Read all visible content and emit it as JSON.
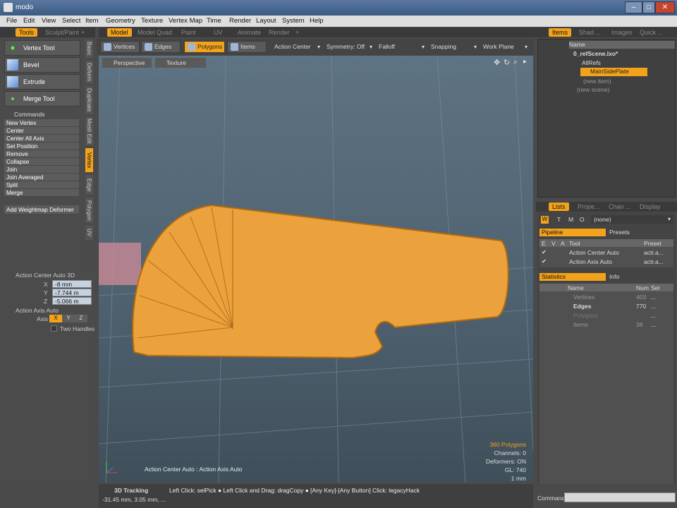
{
  "title": "modo",
  "menu": [
    "File",
    "Edit",
    "View",
    "Select",
    "Item",
    "Geometry",
    "Texture",
    "Vertex Map",
    "Time",
    "Render",
    "Layout",
    "System",
    "Help"
  ],
  "left_tabs": [
    "Tools",
    "Sculpt/Paint",
    "+"
  ],
  "tools": [
    {
      "label": "Vertex Tool",
      "icon": "vertex-tool-icon"
    },
    {
      "label": "Bevel",
      "icon": "bevel-icon"
    },
    {
      "label": "Extrude",
      "icon": "extrude-icon"
    },
    {
      "label": "Merge Tool",
      "icon": "merge-tool-icon"
    }
  ],
  "commands_header": "Commands",
  "commands": [
    "New Vertex",
    "Center",
    "Center All Axis",
    "Set Position",
    "Remove",
    "Collapse",
    "Join",
    "Join Averaged",
    "Split",
    "Merge"
  ],
  "add_weightmap": "Add Weightmap Deformer",
  "vtabs": [
    "Basic",
    "Deform",
    "Duplicate",
    "Mesh Edit",
    "Vertex",
    "Edge",
    "Polygon",
    "UV"
  ],
  "action_center": {
    "title": "Action Center Auto 3D",
    "x_label": "X",
    "y_label": "Y",
    "z_label": "Z",
    "x": "-8 mm",
    "y": "-7.744 m",
    "z": "-5.066 m"
  },
  "action_axis": {
    "title": "Action Axis Auto",
    "axis_label": "Axis",
    "x": "X",
    "y": "Y",
    "z": "Z",
    "two_handles": "Two Handles"
  },
  "viewport_tabs": [
    "Model",
    "Model Quad",
    "Paint",
    "UV",
    "Animate",
    "Render",
    "+"
  ],
  "modes": [
    "Vertices",
    "Edges",
    "Polygons",
    "Items"
  ],
  "dropdowns": [
    "Action Center",
    "Symmetry: Off",
    "Falloff",
    "Snapping",
    "Work Plane"
  ],
  "view": {
    "perspective": "Perspective",
    "texture": "Texture"
  },
  "overlay": {
    "polygons": "360 Polygons",
    "channels": "Channels: 0",
    "deformers": "Deformers: ON",
    "gl": "GL: 740",
    "scale": "1 mm",
    "action_label": "Action Center Auto : Action Axis Auto"
  },
  "status": {
    "tracking": "3D Tracking",
    "coords": "-31.45 mm, 3.05 mm, ...",
    "hint": "Left Click: selPick ● Left Click and Drag: dragCopy ● [Any Key]-[Any Button] Click: legacyHack"
  },
  "right_tabs": [
    "Items",
    "Shad ...",
    "Images",
    "Quick ..."
  ],
  "items": {
    "header": "Name",
    "scene": "0_refScene.lxo*",
    "allrefs": "AllRefs",
    "mainside": "MainSidePlate",
    "new_item": "(new item)",
    "new_scene": "(new scene)"
  },
  "list_tabs": [
    "Lists",
    "Prope...",
    "Chan ...",
    "Display"
  ],
  "wtmo": [
    "W",
    "T",
    "M",
    "O"
  ],
  "none": "(none)",
  "pipeline": {
    "tab1": "Pipeline",
    "tab2": "Presets",
    "cols": [
      "E",
      "V",
      "A",
      "Tool",
      "Preset"
    ],
    "rows": [
      {
        "tool": "Action Center Auto",
        "preset": "actr.a..."
      },
      {
        "tool": "Action Axis Auto",
        "preset": "actr.a..."
      }
    ]
  },
  "stats": {
    "tab1": "Statistics",
    "tab2": "Info",
    "cols": [
      "Name",
      "Num",
      "Sel"
    ],
    "rows": [
      {
        "name": "Vertices",
        "num": "403",
        "sel": "..."
      },
      {
        "name": "Edges",
        "num": "770",
        "sel": "..."
      },
      {
        "name": "Polygons",
        "num": "",
        "sel": "..."
      },
      {
        "name": "Items",
        "num": "38",
        "sel": "..."
      }
    ]
  },
  "command_label": "Command",
  "colors": {
    "accent": "#f3a21b",
    "panel": "#4a4a4a",
    "viewport": "#5a6f80"
  }
}
